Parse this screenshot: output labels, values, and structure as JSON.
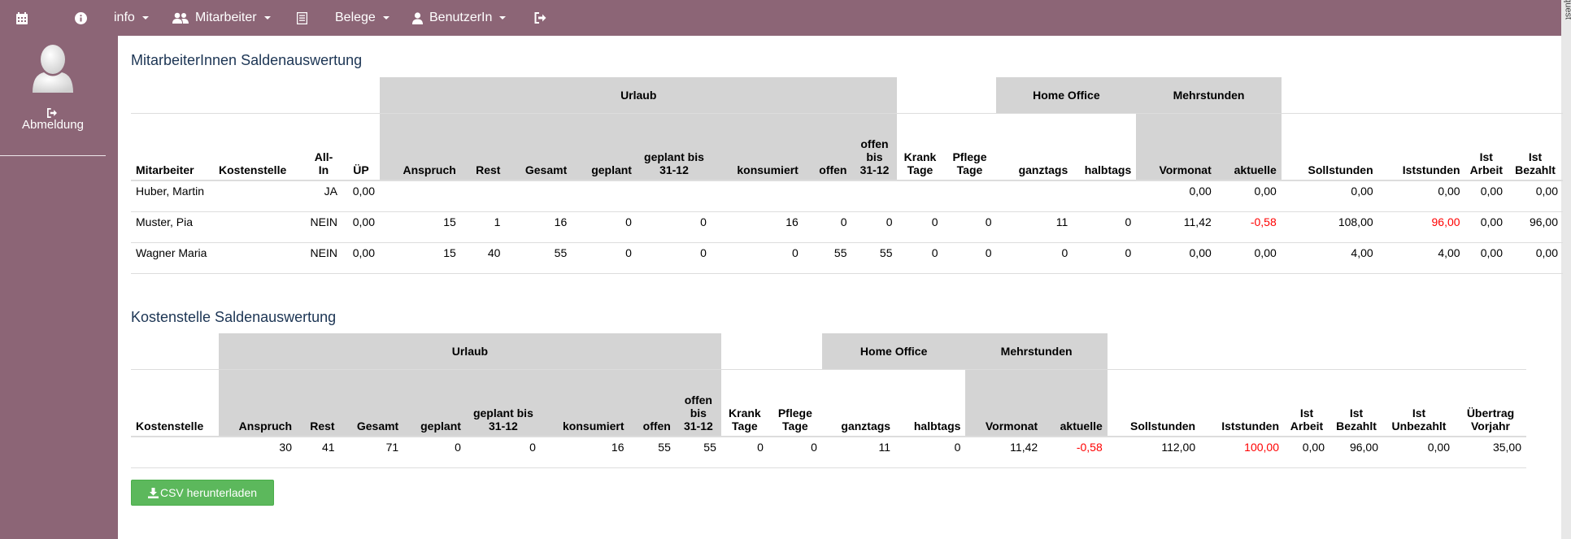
{
  "nav": {
    "info": "info",
    "mitarbeiter": "Mitarbeiter",
    "belege": "Belege",
    "benutzerin": "BenutzerIn"
  },
  "sidebar": {
    "logout": "Abmeldung"
  },
  "side_strip": {
    "text": "Pull Request"
  },
  "section1": {
    "title": "MitarbeiterInnen Saldenauswertung",
    "groups": {
      "urlaub": "Urlaub",
      "homeoffice": "Home Office",
      "mehrstunden": "Mehrstunden"
    },
    "headers": [
      "Mitarbeiter",
      "Kostenstelle",
      "All-In",
      "ÜP",
      "Anspruch",
      "Rest",
      "Gesamt",
      "geplant",
      "geplant bis 31-12",
      "konsumiert",
      "offen",
      "offen bis 31-12",
      "Krank Tage",
      "Pflege Tage",
      "ganztags",
      "halbtags",
      "Vormonat",
      "aktuelle",
      "Sollstunden",
      "Iststunden",
      "Ist Arbeit",
      "Ist Bezahlt"
    ],
    "rows": [
      [
        "Huber, Martin",
        "",
        "JA",
        "0,00",
        "",
        "",
        "",
        "",
        "",
        "",
        "",
        "",
        "",
        "",
        "",
        "",
        "0,00",
        "0,00",
        "0,00",
        "0,00",
        "0,00",
        "0,00"
      ],
      [
        "Muster, Pia",
        "",
        "NEIN",
        "0,00",
        "15",
        "1",
        "16",
        "0",
        "0",
        "16",
        "0",
        "0",
        "0",
        "0",
        "11",
        "0",
        "11,42",
        "-0,58",
        "108,00",
        "96,00",
        "0,00",
        "96,00"
      ],
      [
        "Wagner Maria",
        "",
        "NEIN",
        "0,00",
        "15",
        "40",
        "55",
        "0",
        "0",
        "0",
        "55",
        "55",
        "0",
        "0",
        "0",
        "0",
        "0,00",
        "0,00",
        "4,00",
        "4,00",
        "0,00",
        "0,00"
      ]
    ]
  },
  "section2": {
    "title": "Kostenstelle Saldenauswertung",
    "groups": {
      "urlaub": "Urlaub",
      "homeoffice": "Home Office",
      "mehrstunden": "Mehrstunden"
    },
    "headers": [
      "Kostenstelle",
      "Anspruch",
      "Rest",
      "Gesamt",
      "geplant",
      "geplant bis 31-12",
      "konsumiert",
      "offen",
      "offen bis 31-12",
      "Krank Tage",
      "Pflege Tage",
      "ganztags",
      "halbtags",
      "Vormonat",
      "aktuelle",
      "Sollstunden",
      "Iststunden",
      "Ist Arbeit",
      "Ist Bezahlt",
      "Ist Unbezahlt",
      "Übertrag Vorjahr"
    ],
    "rows": [
      [
        "",
        "30",
        "41",
        "71",
        "0",
        "0",
        "16",
        "55",
        "55",
        "0",
        "0",
        "11",
        "0",
        "11,42",
        "-0,58",
        "112,00",
        "100,00",
        "0,00",
        "96,00",
        "0,00",
        "35,00"
      ]
    ]
  },
  "csv_button": {
    "label": "CSV herunterladen"
  }
}
